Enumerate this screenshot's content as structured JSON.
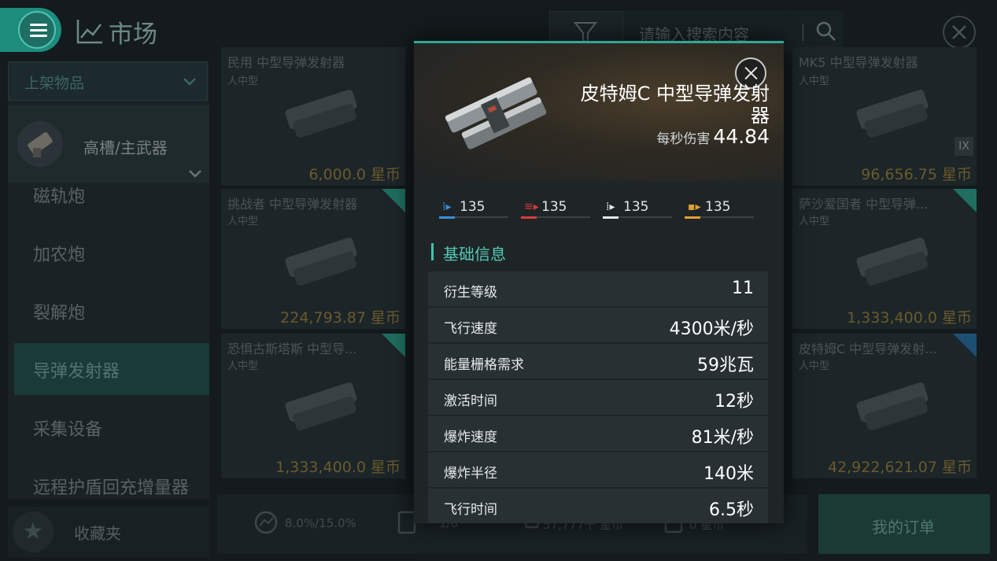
{
  "header": {
    "title": "市场",
    "search_placeholder": "请输入搜索内容"
  },
  "sidebar": {
    "dropdown_label": "上架物品",
    "slot_label": "高槽/主武器",
    "categories": [
      {
        "label": "磁轨炮"
      },
      {
        "label": "加农炮"
      },
      {
        "label": "裂解炮"
      },
      {
        "label": "导弹发射器"
      },
      {
        "label": "采集设备"
      },
      {
        "label": "远程护盾回充增量器"
      }
    ],
    "favorites_label": "收藏夹"
  },
  "grid": {
    "cards": [
      {
        "name": "民用 中型导弹发射器",
        "size": "人中型",
        "price": "6,000.0 星币"
      },
      {
        "name": "MK5 中型导弹发射器",
        "size": "人中型",
        "price": "96,656.75 星币",
        "badge": "IX"
      },
      {
        "name": "挑战者 中型导弹发射器",
        "size": "人中型",
        "price": "224,793.87 星币"
      },
      {
        "name": "萨沙爱国者 中型导弹...",
        "size": "人中型",
        "price": "1,333,400.0 星币"
      },
      {
        "name": "恐惧古斯塔斯 中型导...",
        "size": "人中型",
        "price": "1,333,400.0 星币"
      },
      {
        "name": "皮特姆C 中型导弹发射...",
        "size": "人中型",
        "price": "42,922,621.07 星币"
      }
    ]
  },
  "bottombar": {
    "tax": "8.0%/15.0%",
    "orders_count": "1/8",
    "buy_total": "57,777千 星币",
    "sell_total": "0 星币",
    "my_orders_label": "我的订单"
  },
  "modal": {
    "item_name": "皮特姆C 中型导弹发射器",
    "dps_label": "每秒伤害",
    "dps_value": "44.84",
    "damage": [
      {
        "value": "135",
        "color": "#3b8fd6"
      },
      {
        "value": "135",
        "color": "#d93b3b"
      },
      {
        "value": "135",
        "color": "#e3e7e8"
      },
      {
        "value": "135",
        "color": "#e0a030"
      }
    ],
    "section_title": "基础信息",
    "properties": [
      {
        "label": "衍生等级",
        "value": "11"
      },
      {
        "label": "飞行速度",
        "value": "4300米/秒"
      },
      {
        "label": "能量栅格需求",
        "value": "59兆瓦"
      },
      {
        "label": "激活时间",
        "value": "12秒"
      },
      {
        "label": "爆炸速度",
        "value": "81米/秒"
      },
      {
        "label": "爆炸半径",
        "value": "140米"
      },
      {
        "label": "飞行时间",
        "value": "6.5秒"
      }
    ]
  },
  "colors": {
    "accent": "#2ea895",
    "price": "#c9a54a"
  }
}
